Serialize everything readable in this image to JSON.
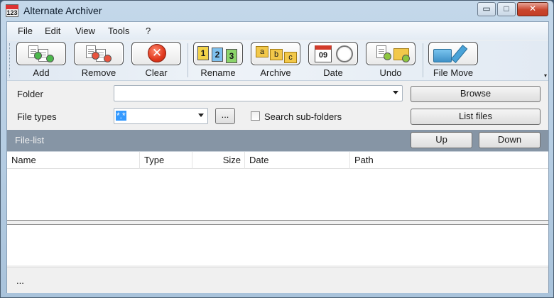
{
  "window": {
    "title": "Alternate Archiver",
    "app_icon_text": "123",
    "minimize": "▭",
    "maximize": "□",
    "close": "✕"
  },
  "menu": {
    "items": [
      "File",
      "Edit",
      "View",
      "Tools",
      "?"
    ]
  },
  "toolbar": {
    "buttons": [
      {
        "label": "Add",
        "icon": "add-files-icon"
      },
      {
        "label": "Remove",
        "icon": "remove-files-icon"
      },
      {
        "label": "Clear",
        "icon": "clear-icon"
      },
      {
        "label": "Rename",
        "icon": "rename-icon"
      },
      {
        "label": "Archive",
        "icon": "archive-folders-icon"
      },
      {
        "label": "Date",
        "icon": "date-icon"
      },
      {
        "label": "Undo",
        "icon": "undo-icon"
      },
      {
        "label": "File Move",
        "icon": "file-move-icon"
      }
    ],
    "rename_digits": [
      "1",
      "2",
      "3"
    ],
    "archive_letters": [
      "a",
      "b",
      "c"
    ],
    "date_day": "09",
    "overflow": "▾"
  },
  "form": {
    "folder_label": "Folder",
    "folder_value": "",
    "filetypes_label": "File types",
    "filetypes_value": "*.*",
    "ellipsis_button": "...",
    "search_subfolders_label": "Search sub-folders",
    "search_subfolders_checked": false,
    "browse_button": "Browse",
    "listfiles_button": "List files"
  },
  "filelist": {
    "title": "File-list",
    "up_button": "Up",
    "down_button": "Down",
    "columns": [
      "Name",
      "Type",
      "Size",
      "Date",
      "Path"
    ],
    "rows": []
  },
  "status": {
    "text": "..."
  },
  "colors": {
    "filelist_bar": "#8695a5",
    "accent_selection": "#3399ff",
    "close_button": "#c9462e"
  }
}
